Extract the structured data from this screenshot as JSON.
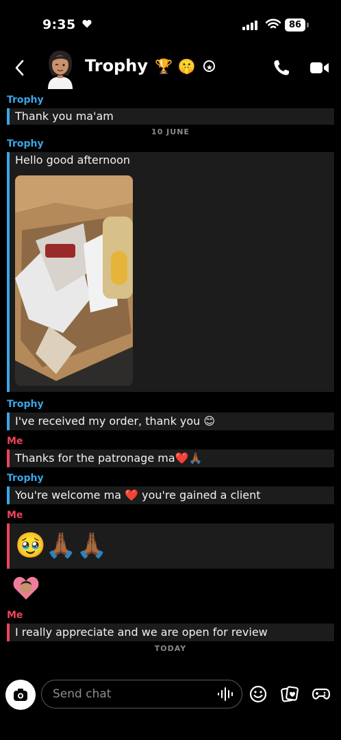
{
  "status_bar": {
    "time": "9:35",
    "battery": "86"
  },
  "header": {
    "contact_name": "Trophy",
    "name_emojis": "🏆 🤫"
  },
  "messages": [
    {
      "sender": "Trophy",
      "text": "Thank you ma'am"
    },
    {
      "date": "10 JUNE"
    },
    {
      "sender": "Trophy",
      "text": "Hello good afternoon"
    },
    {
      "sender": "Trophy",
      "text": "I've received my order, thank you 😊"
    },
    {
      "sender": "Me",
      "text": "Thanks for the patronage ma❤️🙏🏾"
    },
    {
      "sender": "Trophy",
      "text": "You're welcome ma ❤️ you're gained a client"
    },
    {
      "sender": "Me",
      "text": "🥹🙏🏾🙏🏾"
    },
    {
      "sender": "Me",
      "text": "I really appreciate and we are open for review"
    },
    {
      "date": "TODAY"
    }
  ],
  "composer": {
    "placeholder": "Send chat"
  }
}
